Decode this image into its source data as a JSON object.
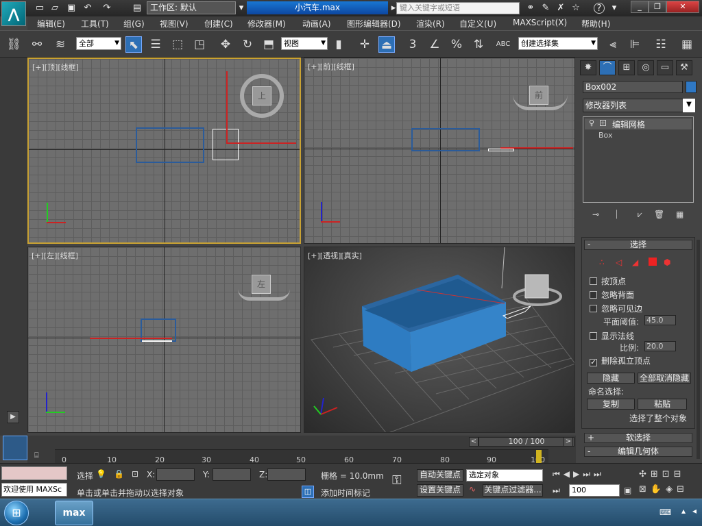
{
  "titlebar": {
    "filename": "小汽车.max",
    "workspace": "工作区: 默认",
    "search_placeholder": "键入关键字或短语",
    "help_icon": "?",
    "logo_text": "max"
  },
  "menus": [
    "编辑(E)",
    "工具(T)",
    "组(G)",
    "视图(V)",
    "创建(C)",
    "修改器(M)",
    "动画(A)",
    "图形编辑器(D)",
    "渲染(R)",
    "自定义(U)",
    "MAXScript(X)",
    "帮助(H)"
  ],
  "toolbar": {
    "filter": "全部",
    "ref_coord": "视图",
    "selection_set": "创建选择集",
    "snap_3d": "3",
    "percent": "%",
    "abc": "ABC"
  },
  "viewports": {
    "top": "[+][顶][线框]",
    "front": "[+][前][线框]",
    "left": "[+][左][线框]",
    "persp": "[+][透视][真实]",
    "cube_top": "上",
    "cube_front": "前",
    "cube_left": "左"
  },
  "command_panel": {
    "object_name": "Box002",
    "object_color": "#2f78c4",
    "modifier_list": "修改器列表",
    "stack": [
      "编辑网格",
      "Box"
    ],
    "selection_rollout": "选择",
    "by_vertex": "按顶点",
    "ignore_backface": "忽略背面",
    "ignore_visible_edges": "忽略可见边",
    "planar_threshold_label": "平面阈值:",
    "planar_threshold": "45.0",
    "show_normals": "显示法线",
    "scale_label": "比例:",
    "scale": "20.0",
    "delete_isolated": "删除孤立顶点",
    "hide": "隐藏",
    "unhide_all": "全部取消隐藏",
    "named_selection": "命名选择:",
    "copy": "复制",
    "paste": "粘贴",
    "selection_info": "选择了整个对象",
    "soft_selection": "软选择",
    "edit_geometry": "编辑几何体"
  },
  "timeline": {
    "frame": "100 / 100",
    "ticks": [
      "0",
      "10",
      "20",
      "30",
      "40",
      "50",
      "60",
      "70",
      "80",
      "90",
      "100"
    ]
  },
  "status": {
    "welcome": "欢迎使用 MAXSc",
    "selected": "选择",
    "x_label": "X:",
    "y_label": "Y:",
    "z_label": "Z:",
    "grid": "栅格 = 10.0mm",
    "prompt": "单击或单击并拖动以选择对象",
    "add_time_tag": "添加时间标记",
    "auto_key": "自动关键点",
    "set_key": "设置关键点",
    "key_target": "选定对象",
    "key_filters": "关键点过滤器...",
    "current_frame": "100"
  }
}
